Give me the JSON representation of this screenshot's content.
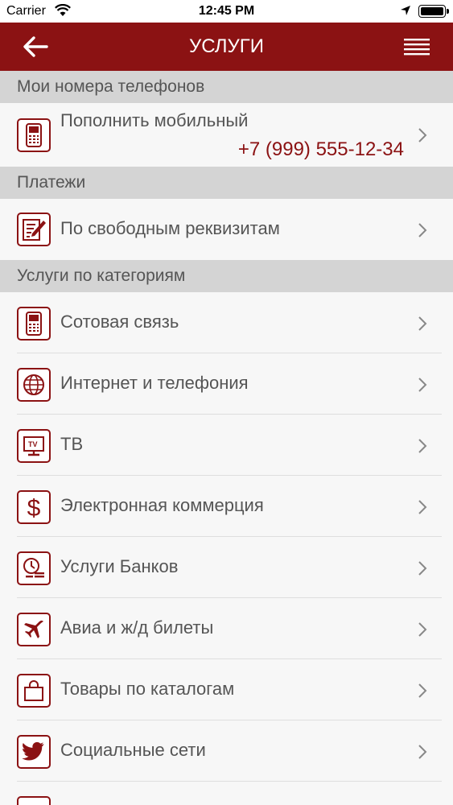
{
  "status": {
    "carrier": "Carrier",
    "time": "12:45 PM"
  },
  "nav": {
    "title": "УСЛУГИ"
  },
  "sections": {
    "phones": {
      "title": "Мои номера телефонов"
    },
    "payments": {
      "title": "Платежи"
    },
    "categories": {
      "title": "Услуги по категориям"
    }
  },
  "items": {
    "topup": {
      "label": "Пополнить мобильный",
      "phone": "+7 (999) 555-12-34"
    },
    "free": {
      "label": "По свободным реквизитам"
    },
    "cat": [
      {
        "label": "Сотовая связь",
        "icon": "mobile-phone-icon"
      },
      {
        "label": "Интернет и телефония",
        "icon": "globe-icon"
      },
      {
        "label": "ТВ",
        "icon": "tv-icon"
      },
      {
        "label": "Электронная коммерция",
        "icon": "dollar-icon"
      },
      {
        "label": "Услуги Банков",
        "icon": "bank-clock-icon"
      },
      {
        "label": "Авиа и ж/д билеты",
        "icon": "airplane-icon"
      },
      {
        "label": "Товары по каталогам",
        "icon": "shopping-bag-icon"
      },
      {
        "label": "Социальные сети",
        "icon": "twitter-bird-icon"
      }
    ]
  },
  "colors": {
    "accent": "#8b1213",
    "header_bg": "#d4d4d4",
    "row_bg": "#f7f7f7"
  }
}
